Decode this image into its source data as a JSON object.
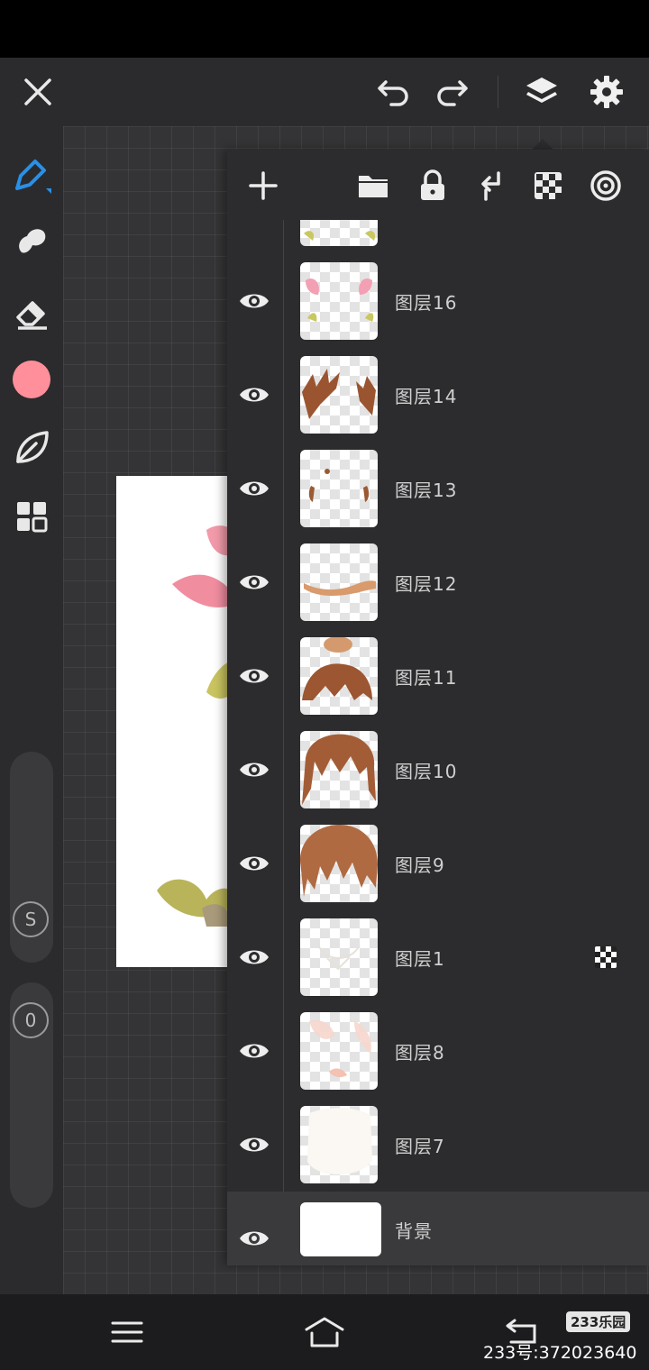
{
  "colors": {
    "accent": "#2a8fe6",
    "current_color": "#ff8f9a",
    "panel_bg": "#2c2c2e"
  },
  "topbar": {
    "icons": [
      "close-icon",
      "undo-icon",
      "redo-icon",
      "layers-icon",
      "settings-icon"
    ]
  },
  "left_toolbar": {
    "tools": [
      "pen-icon",
      "smudge-icon",
      "eraser-icon",
      "color-swatch",
      "leaf-icon",
      "grid-icon"
    ],
    "size_label": "S",
    "opacity_label": "0"
  },
  "layers_panel": {
    "toolbar_icons": [
      "add-icon",
      "folder-icon",
      "lock-icon",
      "merge-down-icon",
      "checker-icon",
      "target-icon"
    ],
    "layers": [
      {
        "name": ""
      },
      {
        "name": "图层16"
      },
      {
        "name": "图层14"
      },
      {
        "name": "图层13"
      },
      {
        "name": "图层12"
      },
      {
        "name": "图层11"
      },
      {
        "name": "图层10"
      },
      {
        "name": "图层9"
      },
      {
        "name": "图层1",
        "alpha_lock": true
      },
      {
        "name": "图层8"
      },
      {
        "name": "图层7"
      },
      {
        "name": "背景",
        "selected": true
      }
    ]
  },
  "navbar": {
    "icons": [
      "menu-icon",
      "home-icon",
      "back-icon"
    ]
  },
  "watermark": {
    "logo": "233乐园",
    "id": "233号:372023640"
  }
}
